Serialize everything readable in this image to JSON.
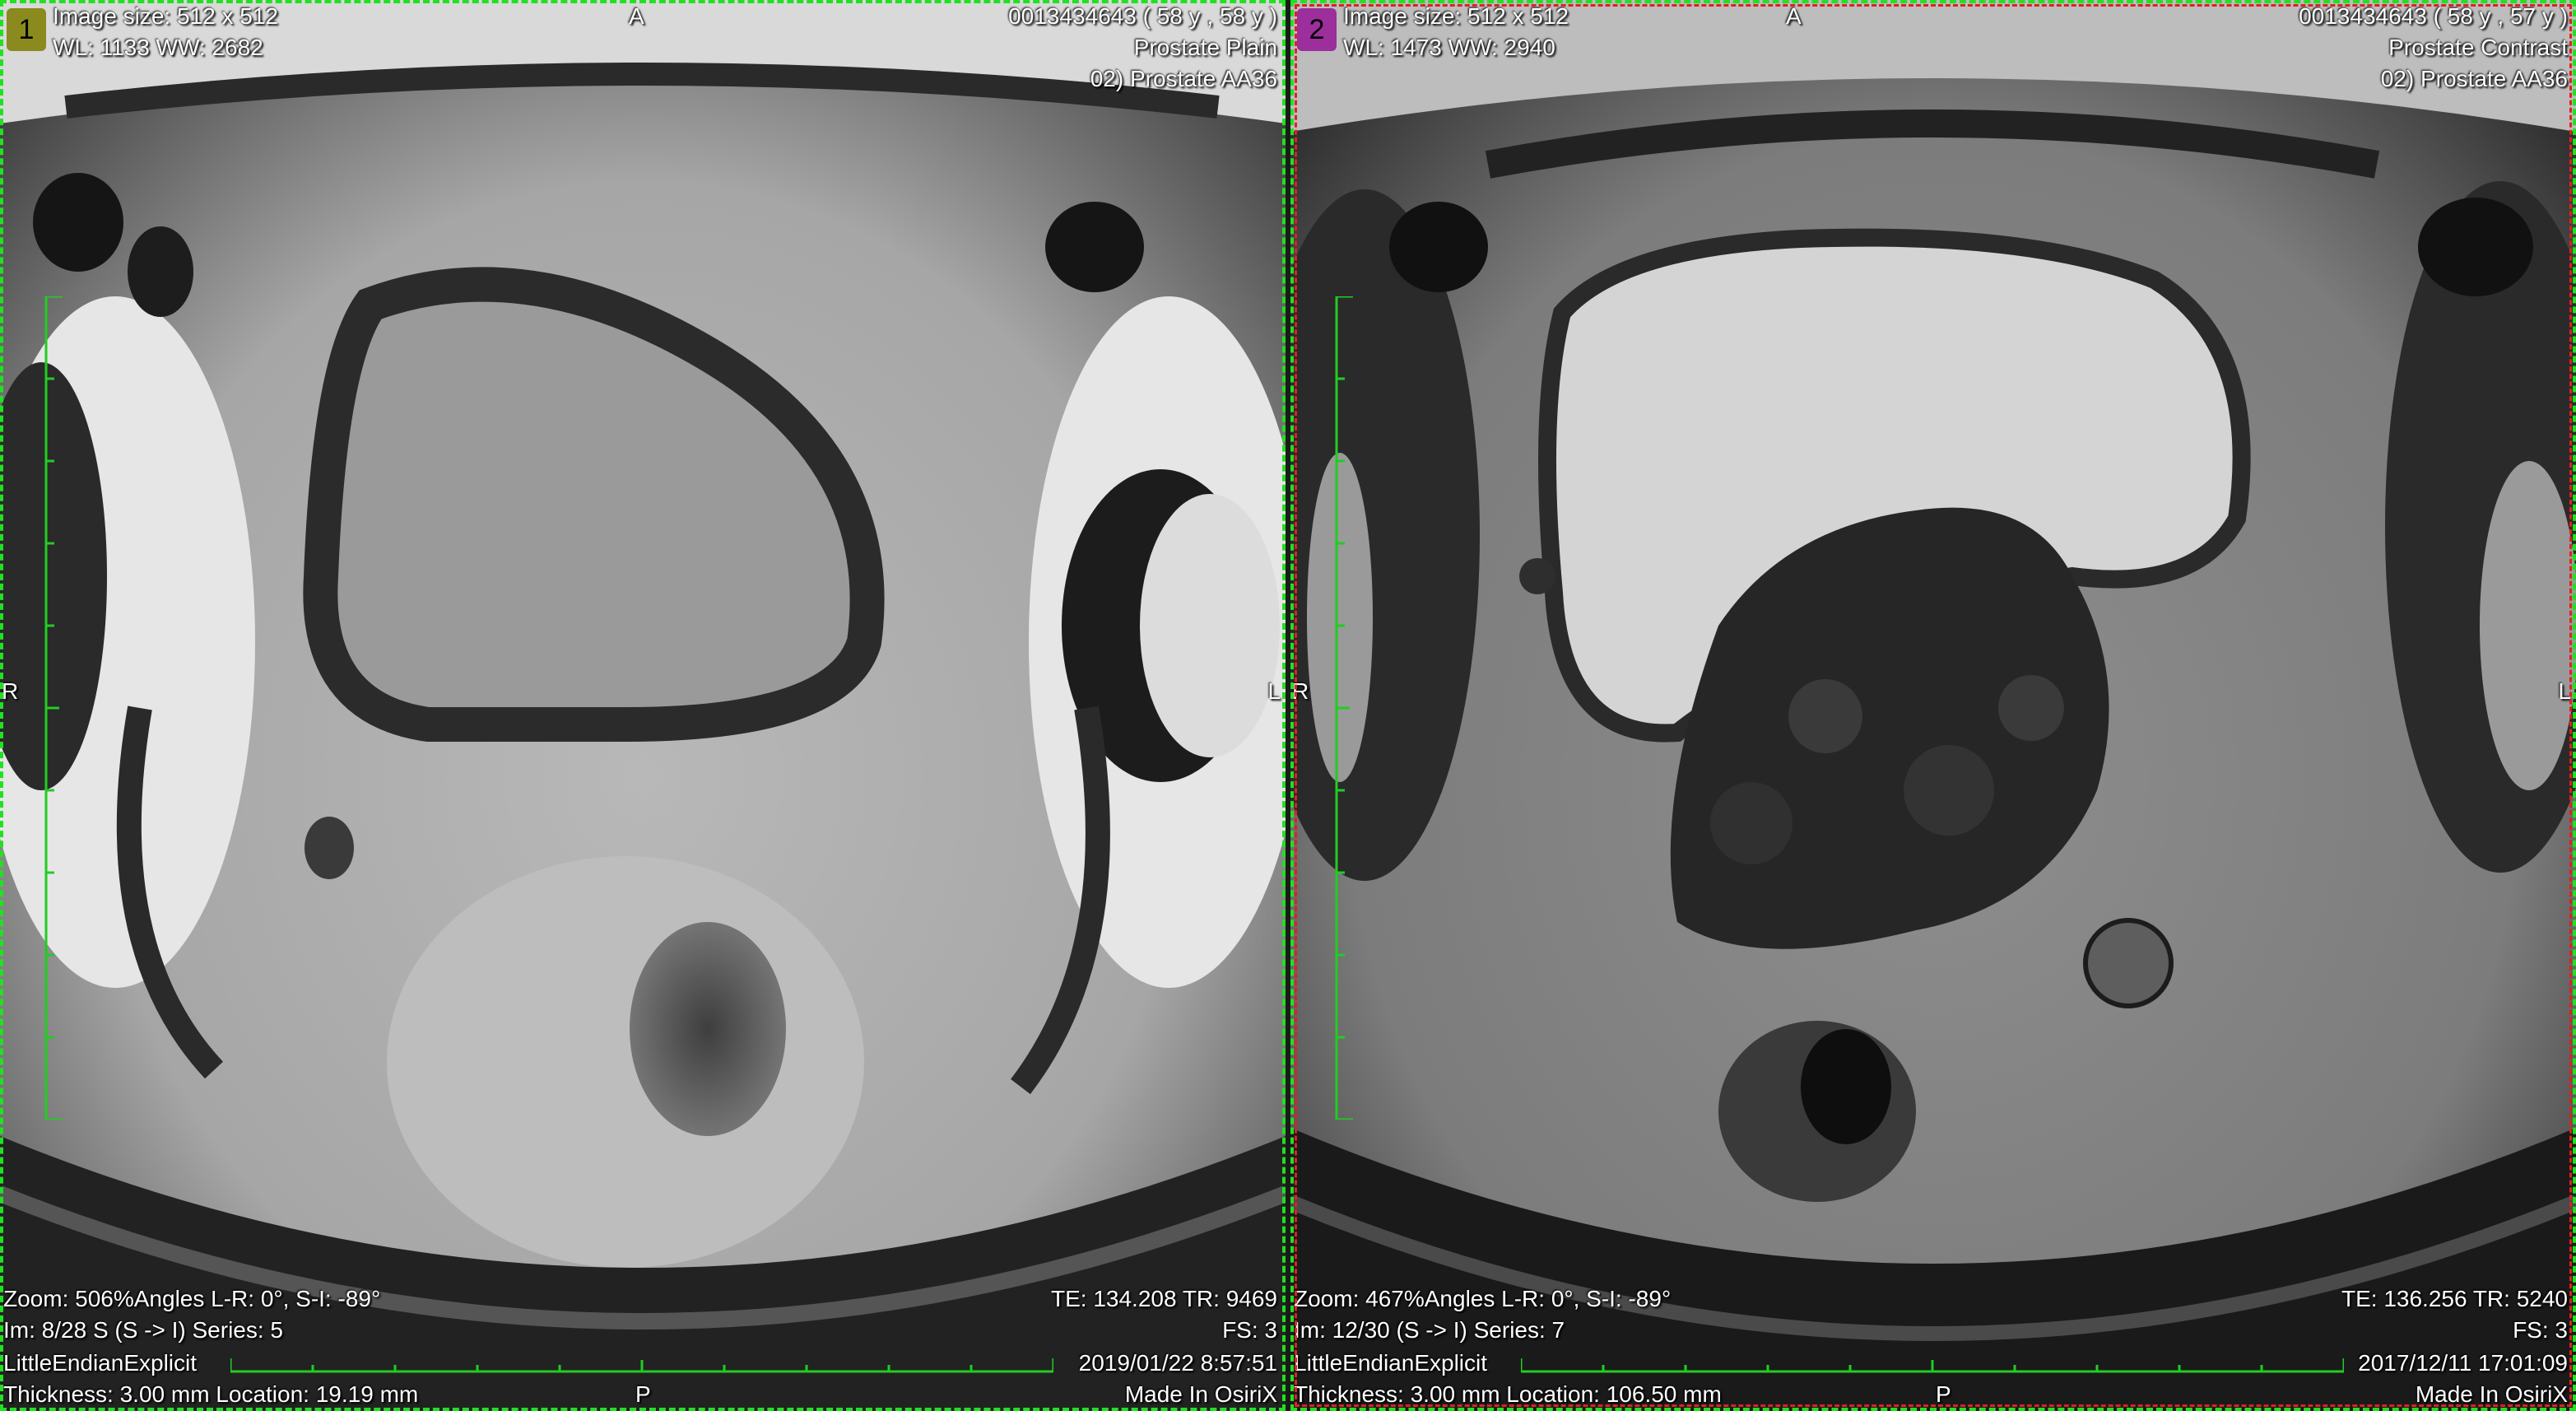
{
  "viewports": [
    {
      "number": "1",
      "badge_color": "#8a8a1e",
      "image_size": "Image size: 512 x 512",
      "window": "WL: 1133 WW: 2682",
      "orient_top": "A",
      "orient_left": "R",
      "orient_right": "L",
      "orient_bottom": "P",
      "patient": "0013434643 ( 58 y , 58 y )",
      "study": "Prostate Plain",
      "series_desc": "02) Prostate AA36",
      "zoom": "Zoom: 506%Angles L-R: 0°, S-I: -89°",
      "image_index": "Im: 8/28  S (S -> I) Series:  5",
      "transfer": "LittleEndianExplicit",
      "thickness": "Thickness: 3.00 mm Location: 19.19 mm",
      "te_tr": "TE:  134.208 TR:  9469",
      "fs": "FS:  3",
      "date": "2019/01/22 8:57:51",
      "made_in": "Made In OsiriX"
    },
    {
      "number": "2",
      "badge_color": "#9c2f9c",
      "image_size": "Image size: 512 x 512",
      "window": "WL: 1473 WW: 2940",
      "orient_top": "A",
      "orient_left": "R",
      "orient_right": "L",
      "orient_bottom": "P",
      "patient": "0013434643 ( 58 y , 57 y )",
      "study": "Prostate Contrast",
      "series_desc": "02) Prostate AA36",
      "zoom": "Zoom: 467%Angles L-R: 0°, S-I: -89°",
      "image_index": "Im: 12/30  (S -> I) Series:  7",
      "transfer": "LittleEndianExplicit",
      "thickness": "Thickness: 3.00 mm Location: 106.50 mm",
      "te_tr": "TE:  136.256 TR:  5240",
      "fs": "FS:  3",
      "date": "2017/12/11 17:01:09",
      "made_in": "Made In OsiriX"
    }
  ],
  "colors": {
    "frame_active": "#22e022",
    "frame_selected": "#e02020",
    "ruler": "#22cc22",
    "overlay_text": "#ffffff"
  }
}
